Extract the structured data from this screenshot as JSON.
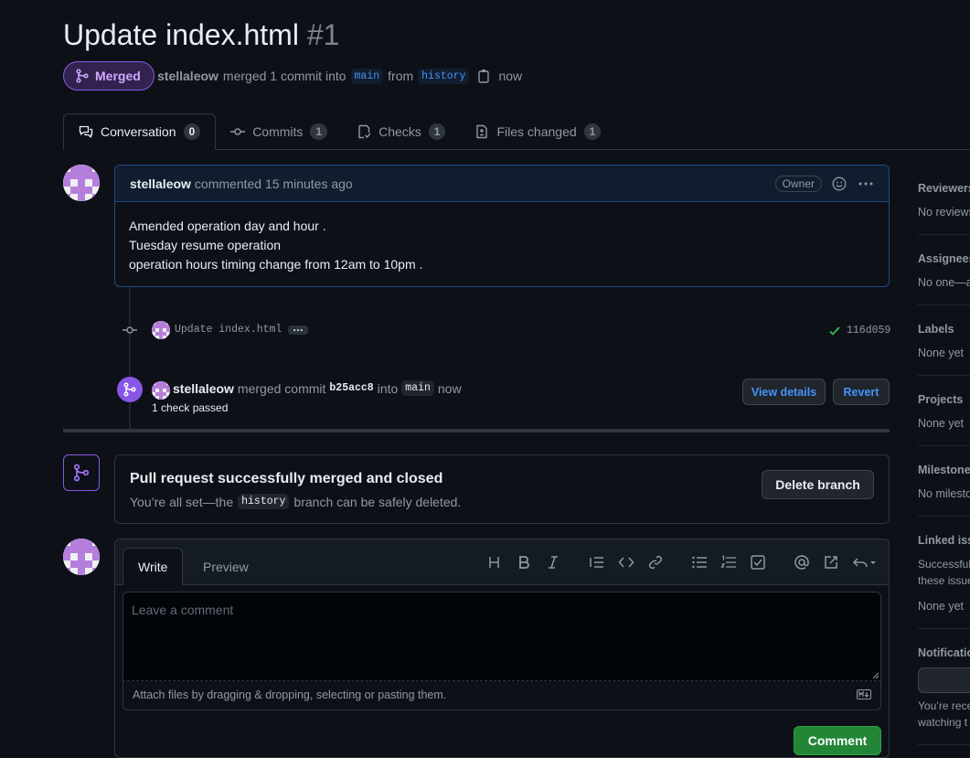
{
  "pr": {
    "title": "Update index.html",
    "number": "#1",
    "state": "Merged",
    "author": "stellaleow",
    "merged_text": "merged 1 commit into",
    "base_branch": "main",
    "from_text": "from",
    "head_branch": "history",
    "time": "now"
  },
  "tabs": [
    {
      "label": "Conversation",
      "count": "0",
      "icon": "comment-discussion-icon"
    },
    {
      "label": "Commits",
      "count": "1",
      "icon": "git-commit-icon"
    },
    {
      "label": "Checks",
      "count": "1",
      "icon": "checklist-icon"
    },
    {
      "label": "Files changed",
      "count": "1",
      "icon": "file-diff-icon"
    }
  ],
  "comment": {
    "author": "stellaleow",
    "action": "commented 15 minutes ago",
    "badge": "Owner",
    "lines": [
      "Amended operation day and hour .",
      "Tuesday resume operation",
      "operation hours timing change from 12am to 10pm ."
    ]
  },
  "commit": {
    "message": "Update index.html",
    "ellipsis": "…",
    "sha": "116d059"
  },
  "merge_event": {
    "author": "stellaleow",
    "text": "merged commit",
    "sha": "b25acc8",
    "into": "into",
    "branch": "main",
    "time": "now",
    "checks": "1 check passed",
    "view_details": "View details",
    "revert": "Revert"
  },
  "merged_box": {
    "title": "Pull request successfully merged and closed",
    "text_before": "You’re all set—the",
    "branch": "history",
    "text_after": "branch can be safely deleted.",
    "delete_button": "Delete branch"
  },
  "editor": {
    "write_tab": "Write",
    "preview_tab": "Preview",
    "placeholder": "Leave a comment",
    "attach_text": "Attach files by dragging & dropping, selecting or pasting them.",
    "comment_button": "Comment"
  },
  "sidebar": {
    "reviewers": {
      "heading": "Reviewers",
      "value": "No reviews"
    },
    "assignees": {
      "heading": "Assignees",
      "value": "No one—a"
    },
    "labels": {
      "heading": "Labels",
      "value": "None yet"
    },
    "projects": {
      "heading": "Projects",
      "value": "None yet"
    },
    "milestone": {
      "heading": "Milestone",
      "value": "No milesto"
    },
    "linked": {
      "heading": "Linked issu",
      "value1": "Successfull",
      "value2": "these issue",
      "value3": "None yet"
    },
    "notifications": {
      "heading": "Notificatio",
      "value1": "You’re rece",
      "value2": "watching t"
    }
  },
  "colors": {
    "background": "#0d1117",
    "merged_purple": "#8957e5",
    "link_blue": "#4493f8",
    "success_green": "#238636"
  }
}
